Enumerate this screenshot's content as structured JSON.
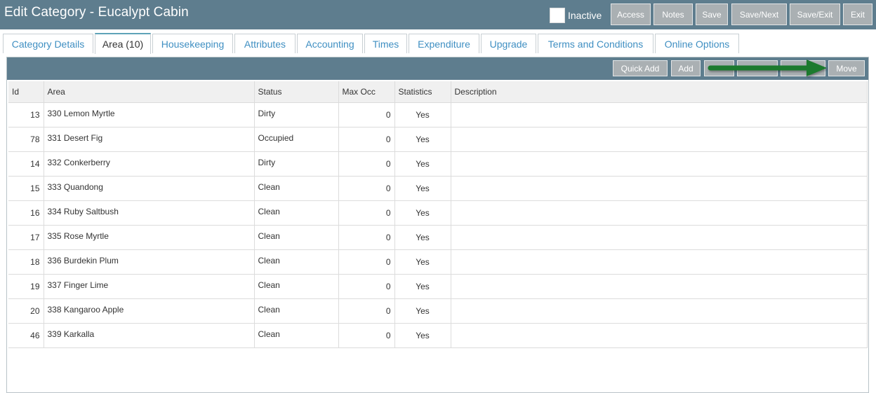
{
  "header": {
    "title": "Edit Category - Eucalypt Cabin",
    "inactive_label": "Inactive",
    "buttons": {
      "access": "Access",
      "notes": "Notes",
      "save": "Save",
      "save_next": "Save/Next",
      "save_exit": "Save/Exit",
      "exit": "Exit"
    }
  },
  "tabs": [
    {
      "label": "Category Details"
    },
    {
      "label": "Area (10)"
    },
    {
      "label": "Housekeeping"
    },
    {
      "label": "Attributes"
    },
    {
      "label": "Accounting"
    },
    {
      "label": "Times"
    },
    {
      "label": "Expenditure"
    },
    {
      "label": "Upgrade"
    },
    {
      "label": "Terms and Conditions"
    },
    {
      "label": "Online Options"
    }
  ],
  "toolbar": {
    "quick_add": "Quick Add",
    "add": "Add",
    "move": "Move"
  },
  "table": {
    "columns": [
      "Id",
      "Area",
      "Status",
      "Max Occ",
      "Statistics",
      "Description"
    ],
    "rows": [
      {
        "id": "13",
        "area": "330 Lemon Myrtle",
        "status": "Dirty",
        "max_occ": "0",
        "statistics": "Yes",
        "description": ""
      },
      {
        "id": "78",
        "area": "331 Desert Fig",
        "status": "Occupied",
        "max_occ": "0",
        "statistics": "Yes",
        "description": ""
      },
      {
        "id": "14",
        "area": "332 Conkerberry",
        "status": "Dirty",
        "max_occ": "0",
        "statistics": "Yes",
        "description": ""
      },
      {
        "id": "15",
        "area": "333 Quandong",
        "status": "Clean",
        "max_occ": "0",
        "statistics": "Yes",
        "description": ""
      },
      {
        "id": "16",
        "area": "334 Ruby Saltbush",
        "status": "Clean",
        "max_occ": "0",
        "statistics": "Yes",
        "description": ""
      },
      {
        "id": "17",
        "area": "335 Rose Myrtle",
        "status": "Clean",
        "max_occ": "0",
        "statistics": "Yes",
        "description": ""
      },
      {
        "id": "18",
        "area": "336 Burdekin Plum",
        "status": "Clean",
        "max_occ": "0",
        "statistics": "Yes",
        "description": ""
      },
      {
        "id": "19",
        "area": "337 Finger Lime",
        "status": "Clean",
        "max_occ": "0",
        "statistics": "Yes",
        "description": ""
      },
      {
        "id": "20",
        "area": "338 Kangaroo Apple",
        "status": "Clean",
        "max_occ": "0",
        "statistics": "Yes",
        "description": ""
      },
      {
        "id": "46",
        "area": "339 Karkalla",
        "status": "Clean",
        "max_occ": "0",
        "statistics": "Yes",
        "description": ""
      }
    ]
  },
  "colors": {
    "header_bg": "#5e7d8e",
    "button_bg": "#aab0b3",
    "tab_text": "#3f8fc2",
    "arrow": "#1e7a2e"
  },
  "icons": {
    "annotation": "right-arrow-icon"
  }
}
